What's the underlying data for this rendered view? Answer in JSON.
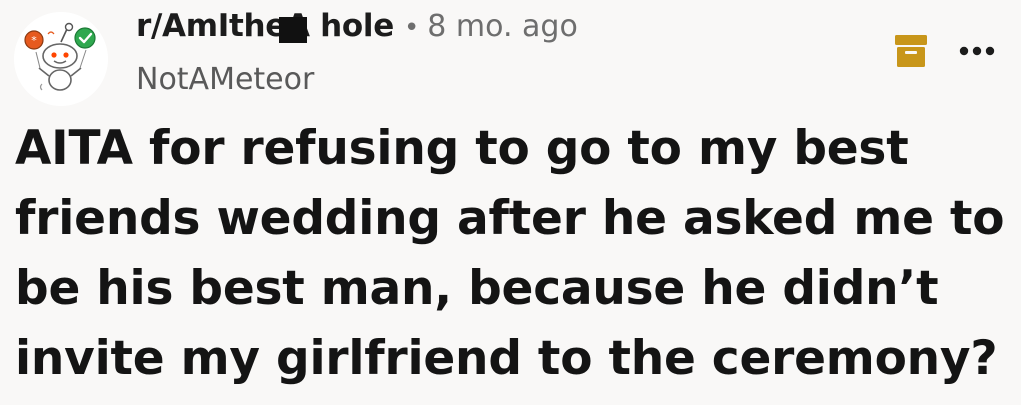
{
  "post": {
    "subreddit": "r/AmItheA  hole",
    "separator": "•",
    "time_ago": "8 mo. ago",
    "username": "NotAMeteor",
    "title": "AITA for refusing to go to my best friends wedding after he asked me to be his best man, because he didn’t invite my girlfriend to the ceremony?"
  },
  "icons": {
    "avatar": "reddit-snoo-avatar-icon",
    "archive": "archive-icon",
    "more": "more-options-icon"
  },
  "colors": {
    "background": "#f9f8f7",
    "archive_icon": "#c8961a",
    "verified_badge": "#2fa84f"
  }
}
